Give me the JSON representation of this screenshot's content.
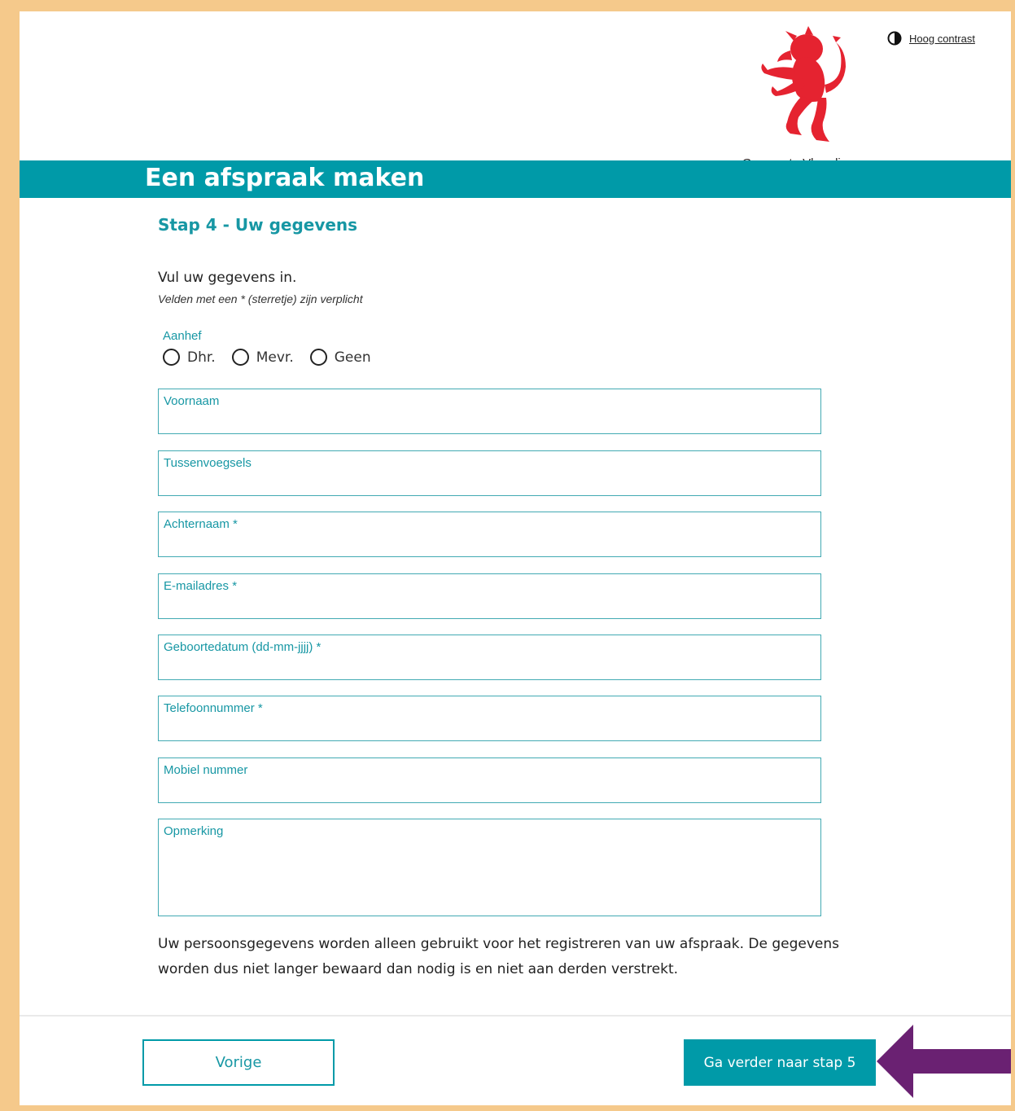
{
  "header": {
    "contrast_link": "Hoog contrast",
    "contrast_icon": "contrast-icon",
    "logo_text": "Gemeente Vlaardingen",
    "logo_icon": "red-lion-icon",
    "brand_color": "#009aa8",
    "logo_color": "#e52330"
  },
  "page": {
    "title": "Een afspraak maken",
    "step_title": "Stap 4 - Uw gegevens",
    "intro": "Vul uw gegevens in.",
    "required_note": "Velden met een * (sterretje) zijn verplicht"
  },
  "form": {
    "salutation": {
      "label": "Aanhef",
      "options": [
        "Dhr.",
        "Mevr.",
        "Geen"
      ],
      "selected": null
    },
    "fields": [
      {
        "label": "Voornaam",
        "value": ""
      },
      {
        "label": "Tussenvoegsels",
        "value": ""
      },
      {
        "label": "Achternaam *",
        "value": ""
      },
      {
        "label": "E-mailadres *",
        "value": ""
      },
      {
        "label": "Geboortedatum (dd-mm-jjjj) *",
        "value": ""
      },
      {
        "label": "Telefoonnummer *",
        "value": ""
      },
      {
        "label": "Mobiel nummer",
        "value": ""
      },
      {
        "label": "Opmerking",
        "value": ""
      }
    ]
  },
  "privacy_text": "Uw persoonsgegevens worden alleen gebruikt voor het registreren van uw afspraak. De gegevens worden dus niet langer bewaard dan nodig is en niet aan derden verstrekt.",
  "navigation": {
    "prev_label": "Vorige",
    "next_label": "Ga verder naar stap 5"
  },
  "annotation": {
    "arrow_icon": "left-arrow-icon",
    "arrow_color": "#6a2172"
  }
}
